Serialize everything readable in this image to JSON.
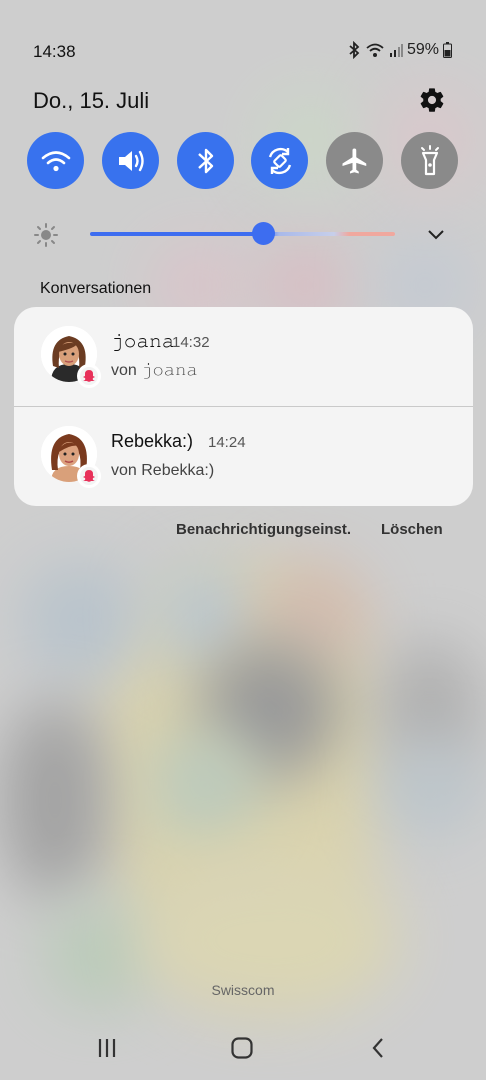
{
  "status_bar": {
    "time": "14:38",
    "battery": "59%",
    "icons": [
      "bluetooth-icon",
      "wifi-icon",
      "signal-icon",
      "battery-icon"
    ]
  },
  "header": {
    "date": "Do., 15. Juli",
    "settings_icon": "gear-icon"
  },
  "quick_toggles": [
    {
      "name": "wifi",
      "icon": "wifi-icon",
      "state": "on"
    },
    {
      "name": "sound",
      "icon": "speaker-icon",
      "state": "on"
    },
    {
      "name": "bluetooth",
      "icon": "bluetooth-icon",
      "state": "on"
    },
    {
      "name": "auto-rotate",
      "icon": "rotate-icon",
      "state": "on"
    },
    {
      "name": "airplane-mode",
      "icon": "airplane-icon",
      "state": "off"
    },
    {
      "name": "flashlight",
      "icon": "flashlight-icon",
      "state": "off"
    }
  ],
  "brightness": {
    "level": 0.57
  },
  "conversations": {
    "title": "Konversationen",
    "items": [
      {
        "name": "𝚓𝚘𝚊𝚗𝚊",
        "time": "14:32",
        "text_prefix": "von ",
        "text_name": "𝚓𝚘𝚊𝚗𝚊"
      },
      {
        "name": "Rebekka:)",
        "time": "14:24",
        "text_prefix": "von ",
        "text_name": "Rebekka:)"
      }
    ]
  },
  "actions": {
    "settings_label": "Benachrichtigungseinst.",
    "clear_label": "Löschen"
  },
  "carrier": "Swisscom",
  "colors": {
    "accent": "#3872ee",
    "toggle_off": "#8a8a8a",
    "card_bg": "#f4f4f4"
  }
}
